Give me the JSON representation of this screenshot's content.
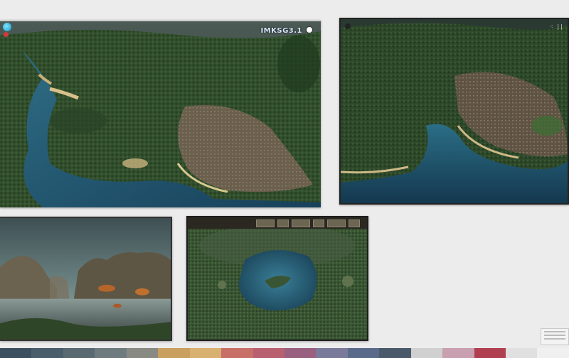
{
  "views": {
    "main_view": {
      "overlay_label": "IMKSG3.1",
      "markers": [
        "blue-marker",
        "red-marker",
        "white-dot"
      ]
    },
    "secondary_view": {
      "overlay_label": "⁖ ||"
    },
    "landscape_view": {},
    "lake_view": {
      "toolbar_icons": [
        "toolbar-button",
        "toolbar-button",
        "toolbar-button",
        "toolbar-button",
        "toolbar-button",
        "toolbar-button"
      ]
    }
  },
  "bottom_strip_colors": [
    "#3c5060",
    "#4a5e6c",
    "#5a6a72",
    "#6e7c80",
    "#8a8a84",
    "#c9a060",
    "#d8b070",
    "#c87068",
    "#b86070",
    "#9a6080",
    "#7a7a9a",
    "#5a6a8a",
    "#4a5a6a",
    "#d0d0d0",
    "#c8a0b0",
    "#b04050",
    "#e0e0e0",
    "#f0f0f0"
  ],
  "colors": {
    "water_deep": "#1d4a63",
    "water_light": "#3f7f92",
    "forest": "#2f4a2c",
    "terrain_brown": "#6a5a44",
    "background": "#ececec"
  }
}
